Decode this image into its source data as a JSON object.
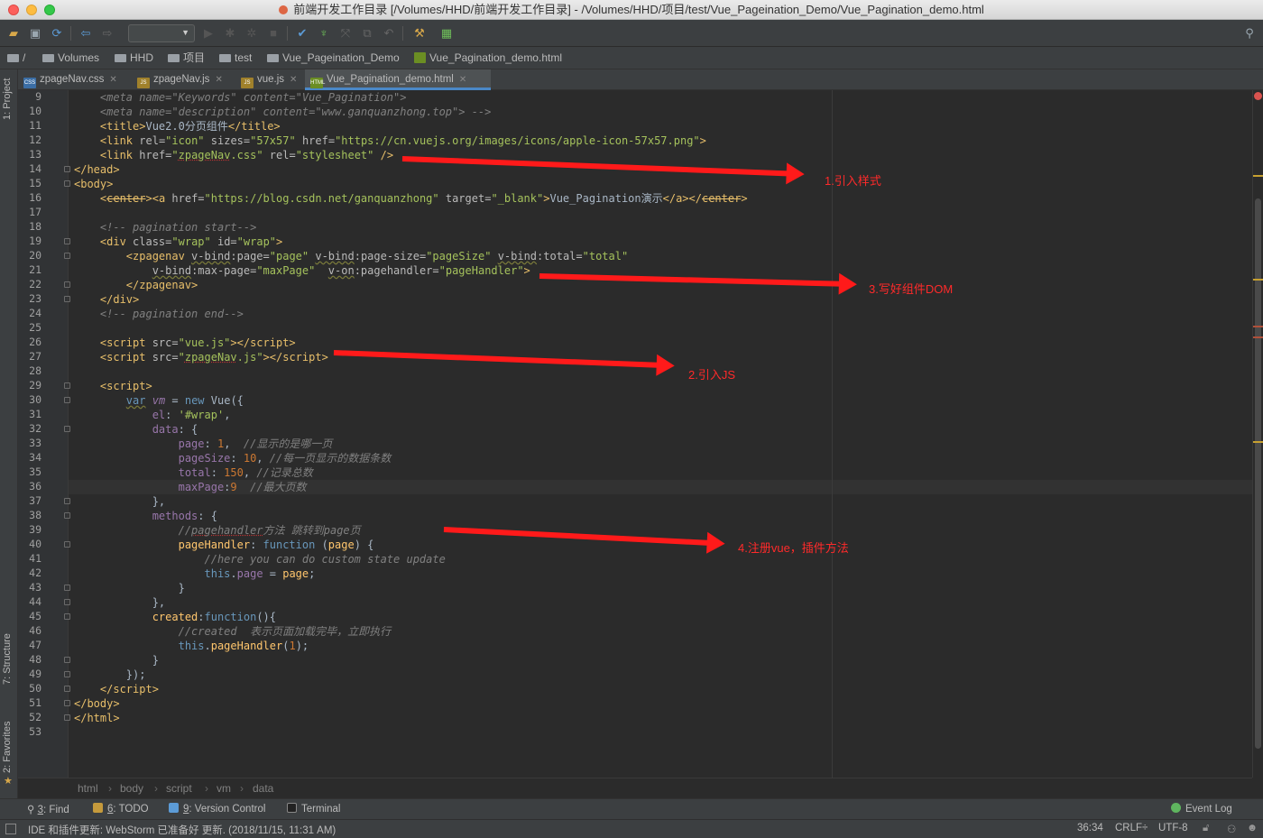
{
  "window": {
    "title": "前端开发工作目录 [/Volumes/HHD/前端开发工作目录] - /Volumes/HHD/项目/test/Vue_Pageination_Demo/Vue_Pagination_demo.html"
  },
  "breadcrumb": {
    "items": [
      "/",
      "Volumes",
      "HHD",
      "项目",
      "test",
      "Vue_Pageination_Demo",
      "Vue_Pagination_demo.html"
    ]
  },
  "tabs": [
    {
      "label": "zpageNav.css",
      "icon": "CSS"
    },
    {
      "label": "zpageNav.js",
      "icon": "JS"
    },
    {
      "label": "vue.js",
      "icon": "JS"
    },
    {
      "label": "Vue_Pagination_demo.html",
      "icon": "HTML"
    }
  ],
  "side_tools": {
    "project": "1: Project",
    "structure": "7: Structure",
    "favorites": "2: Favorites"
  },
  "line_numbers": [
    "9",
    "10",
    "11",
    "12",
    "13",
    "14",
    "15",
    "16",
    "17",
    "18",
    "19",
    "20",
    "21",
    "22",
    "23",
    "24",
    "25",
    "26",
    "27",
    "28",
    "29",
    "30",
    "31",
    "32",
    "33",
    "34",
    "35",
    "36",
    "37",
    "38",
    "39",
    "40",
    "41",
    "42",
    "43",
    "44",
    "45",
    "46",
    "47",
    "48",
    "49",
    "50",
    "51",
    "52",
    "53"
  ],
  "annotations": {
    "a1": "1.引入样式",
    "a2": "2.引入JS",
    "a3": "3.写好组件DOM",
    "a4": "4.注册vue，插件方法"
  },
  "editor_breadcrumb": [
    "html",
    "body",
    "script",
    "vm",
    "data"
  ],
  "tool_windows": [
    {
      "key": "3",
      "label": ": Find"
    },
    {
      "key": "6",
      "label": ": TODO"
    },
    {
      "key": "9",
      "label": ": Version Control"
    },
    {
      "key": "",
      "label": "Terminal"
    }
  ],
  "event_log": "Event Log",
  "status": {
    "message": "IDE 和插件更新: WebStorm 已准备好 更新. (2018/11/15, 11:31 AM)",
    "position": "36:34",
    "line_sep": "CRLF÷",
    "encoding": "UTF-8"
  },
  "colors": {
    "accent": "#4a88c7",
    "annotation": "#ff1a1a",
    "editor_bg": "#2b2b2b"
  }
}
